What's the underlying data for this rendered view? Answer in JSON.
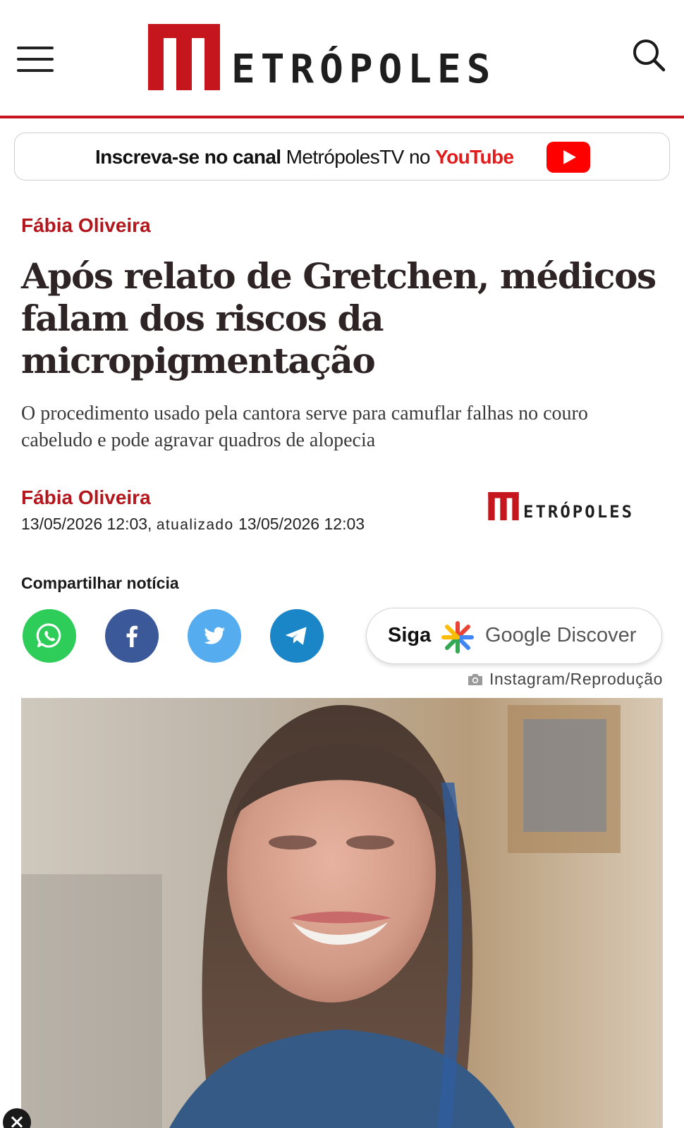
{
  "header": {
    "brand": "ETRÓPOLES",
    "menu_icon": "hamburger-menu-icon",
    "search_icon": "search-icon",
    "accent_color": "#c4161c"
  },
  "youtube_banner": {
    "prefix": "Inscreva-se no canal",
    "channel": "MetrópolesTV",
    "connector": "no",
    "platform": "YouTube",
    "icon": "youtube-play-icon"
  },
  "article": {
    "section": "Fábia Oliveira",
    "headline": "Após relato de Gretchen, médicos falam dos riscos da micropigmentação",
    "subtitle": "O procedimento usado pela cantora serve para camuflar falhas no couro cabeludo e pode agravar quadros de alopecia",
    "author": "Fábia Oliveira",
    "published": "13/05/2026 12:03,",
    "updated_label": "atualizado",
    "updated": "13/05/2026 12:03",
    "publisher_logo": "ETRÓPOLES"
  },
  "share": {
    "label": "Compartilhar notícia",
    "buttons": [
      "whatsapp-icon",
      "facebook-icon",
      "twitter-icon",
      "telegram-icon"
    ],
    "discover_prefix": "Siga",
    "discover_label": "Google Discover"
  },
  "photo": {
    "credit": "Instagram/Reprodução",
    "credit_icon": "camera-icon"
  }
}
